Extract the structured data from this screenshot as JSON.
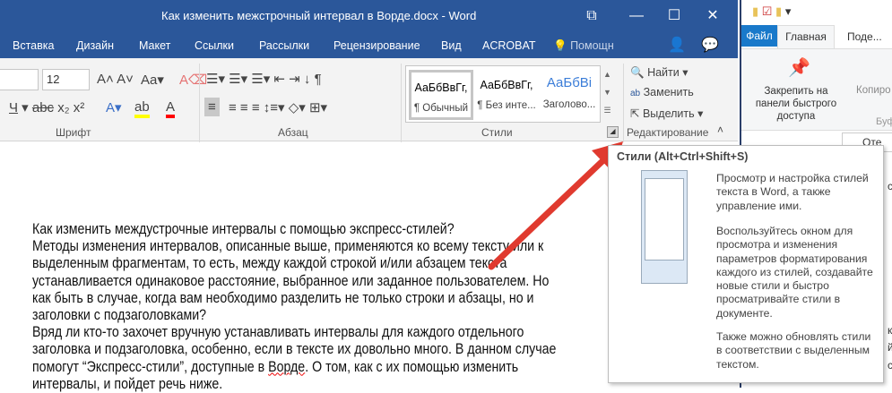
{
  "word": {
    "title": "Как изменить межстрочный интервал в Ворде.docx - Word",
    "tabs": [
      "Вставка",
      "Дизайн",
      "Макет",
      "Ссылки",
      "Рассылки",
      "Рецензирование",
      "Вид",
      "ACROBAT",
      "Помощн"
    ],
    "font_size": "12",
    "groups": {
      "font": "Шрифт",
      "paragraph": "Абзац",
      "styles": "Стили",
      "editing": "Редактирование"
    },
    "styles": [
      {
        "preview": "АаБбВвГг,",
        "name": "¶ Обычный"
      },
      {
        "preview": "АаБбВвГг,",
        "name": "¶ Без инте..."
      },
      {
        "preview": "АаБбВі",
        "name": "Заголово..."
      }
    ],
    "editing": {
      "find": "Найти",
      "replace": "Заменить",
      "select": "Выделить"
    },
    "colors": {
      "title_bar": "#2b579a",
      "highlight": "#ffff00",
      "font_color": "#ff0000",
      "arrow": "#e03a2f"
    }
  },
  "document": {
    "lines": [
      "Как изменить междустрочные интервалы с помощью экспресс-стилей?",
      "Методы изменения интервалов, описанные выше, применяются ко всему тексту или к",
      "выделенным фрагментам, то есть, между каждой строкой и/или абзацем текста",
      "устанавливается одинаковое расстояние, выбранное или заданное пользователем. Но",
      "как быть в случае, когда вам необходимо разделить не только строки и абзацы, но и",
      "заголовки с подзаголовками?",
      "Вряд ли кто-то захочет вручную устанавливать интервалы для каждого отдельного",
      "заголовка и подзаголовка, особенно, если в тексте их довольно много. В данном случае"
    ],
    "line9_a": "помогут “Экспресс-стили”, доступные в ",
    "line9_b": "Ворде",
    "line9_c": ". О том, как с их помощью изменить",
    "line10": "интервалы, и пойдет речь ниже."
  },
  "tooltip": {
    "title": "Стили (Alt+Ctrl+Shift+S)",
    "p1": "Просмотр и настройка стилей текста в Word, а также управление ими.",
    "p2": "Воспользуйтесь окном для просмотра и изменения параметров форматирования каждого из стилей, создавайте новые стили и быстро просматривайте стили в документе.",
    "p3": "Также можно обновлять стили в соответствии с выделенным текстом."
  },
  "explorer": {
    "tabs": [
      "Файл",
      "Главная",
      "Поде..."
    ],
    "pin": "Закрепить на панели быстрого доступа",
    "copy": "Копиро",
    "group": "Буф",
    "address": "Оте",
    "frag": [
      "ст",
      "к",
      "йк",
      "ск"
    ]
  }
}
